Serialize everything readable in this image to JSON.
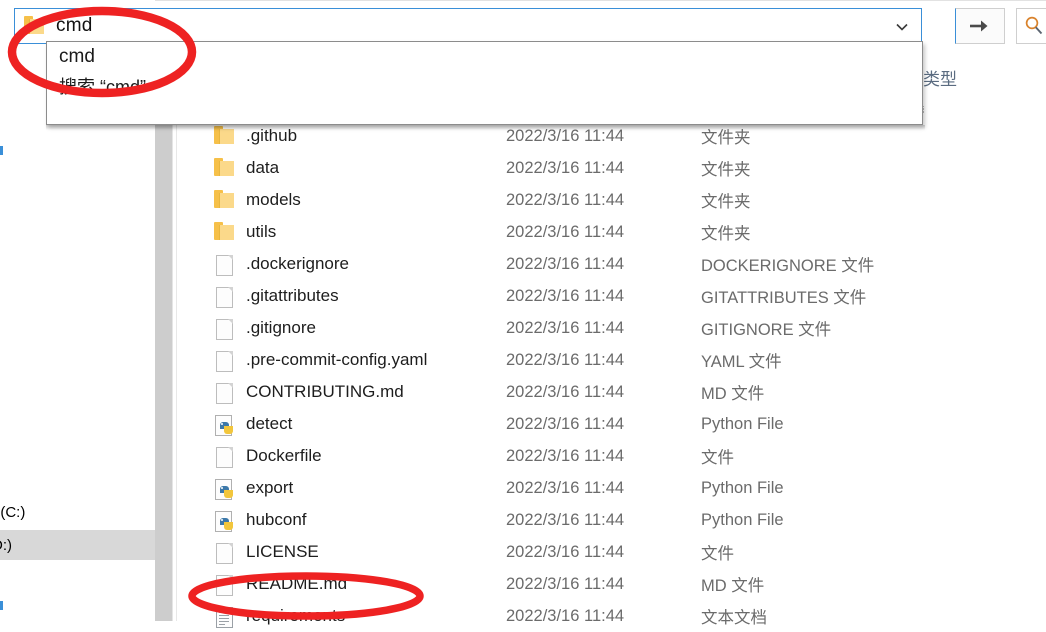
{
  "window": {
    "app": "file-explorer"
  },
  "address_bar": {
    "icon": "folder-icon",
    "value": "cmd",
    "placeholder": "cmd",
    "chevron_icon": "chevron-down-icon",
    "go_icon": "arrow-right-icon",
    "go_label": "→"
  },
  "search_box": {
    "icon": "search-icon",
    "value": ""
  },
  "autocomplete": {
    "items": [
      {
        "label": "cmd",
        "kind": "history"
      },
      {
        "label": "搜索 “cmd”",
        "kind": "search-action"
      }
    ]
  },
  "columns": {
    "type_header": "类型"
  },
  "sidebar": {
    "items": [
      {
        "label": "t (C:)",
        "selected": false
      },
      {
        "label": "D:)",
        "selected": true
      },
      {
        "label": ")",
        "selected": false
      }
    ]
  },
  "file_list": {
    "rows": [
      {
        "name": ".github",
        "icon": "folder-icon",
        "date": "2022/3/16 11:44",
        "type": "文件夹"
      },
      {
        "name": "data",
        "icon": "folder-icon",
        "date": "2022/3/16 11:44",
        "type": "文件夹"
      },
      {
        "name": "models",
        "icon": "folder-icon",
        "date": "2022/3/16 11:44",
        "type": "文件夹"
      },
      {
        "name": "utils",
        "icon": "folder-icon",
        "date": "2022/3/16 11:44",
        "type": "文件夹"
      },
      {
        "name": ".dockerignore",
        "icon": "file-icon",
        "date": "2022/3/16 11:44",
        "type": "DOCKERIGNORE 文件"
      },
      {
        "name": ".gitattributes",
        "icon": "file-icon",
        "date": "2022/3/16 11:44",
        "type": "GITATTRIBUTES 文件"
      },
      {
        "name": ".gitignore",
        "icon": "file-icon",
        "date": "2022/3/16 11:44",
        "type": "GITIGNORE 文件"
      },
      {
        "name": ".pre-commit-config.yaml",
        "icon": "file-icon",
        "date": "2022/3/16 11:44",
        "type": "YAML 文件"
      },
      {
        "name": "CONTRIBUTING.md",
        "icon": "file-icon",
        "date": "2022/3/16 11:44",
        "type": "MD 文件"
      },
      {
        "name": "detect",
        "icon": "python-file-icon",
        "date": "2022/3/16 11:44",
        "type": "Python File"
      },
      {
        "name": "Dockerfile",
        "icon": "file-icon",
        "date": "2022/3/16 11:44",
        "type": "文件"
      },
      {
        "name": "export",
        "icon": "python-file-icon",
        "date": "2022/3/16 11:44",
        "type": "Python File"
      },
      {
        "name": "hubconf",
        "icon": "python-file-icon",
        "date": "2022/3/16 11:44",
        "type": "Python File"
      },
      {
        "name": "LICENSE",
        "icon": "file-icon",
        "date": "2022/3/16 11:44",
        "type": "文件"
      },
      {
        "name": "README.md",
        "icon": "file-icon",
        "date": "2022/3/16 11:44",
        "type": "MD 文件"
      },
      {
        "name": "requirements",
        "icon": "text-document-icon",
        "date": "2022/3/16 11:44",
        "type": "文本文档"
      }
    ]
  },
  "annotations": {
    "color": "#ee2222",
    "ellipses": [
      {
        "target": "address-bar-and-suggestion"
      },
      {
        "target": "requirements-row"
      }
    ]
  }
}
